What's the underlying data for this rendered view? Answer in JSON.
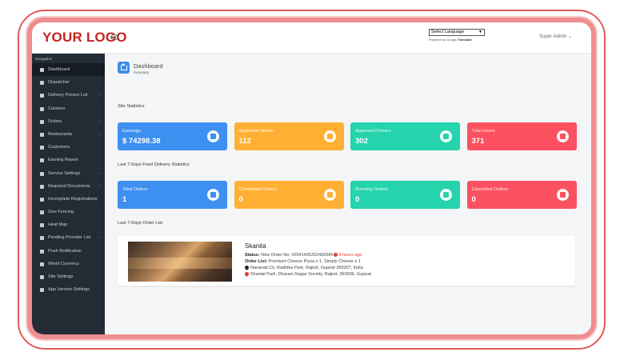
{
  "topbar": {
    "logo": "YOUR LOGO",
    "language_select": "Select Language",
    "powered_prefix": "Powered by Google",
    "powered_brand": "Translate",
    "user": "Super Admin"
  },
  "sidebar": {
    "title": "Navigation",
    "items": [
      {
        "label": "Dashboard",
        "icon": "home-icon",
        "chevron": false
      },
      {
        "label": "Dispatcher",
        "icon": "dispatcher-icon",
        "chevron": false
      },
      {
        "label": "Delivery Person List",
        "icon": "car-icon",
        "chevron": true
      },
      {
        "label": "Cuisines",
        "icon": "list-icon",
        "chevron": false
      },
      {
        "label": "Orders",
        "icon": "lock-icon",
        "chevron": true
      },
      {
        "label": "Restaurants",
        "icon": "store-icon",
        "chevron": true
      },
      {
        "label": "Customers",
        "icon": "user-icon",
        "chevron": false
      },
      {
        "label": "Earning Report",
        "icon": "report-icon",
        "chevron": false
      },
      {
        "label": "Service Settings",
        "icon": "cog-icon",
        "chevron": true
      },
      {
        "label": "Required Documents",
        "icon": "file-icon",
        "chevron": true
      },
      {
        "label": "Incomplete Registrations",
        "icon": "user-plus-icon",
        "chevron": false
      },
      {
        "label": "Geo Fencing",
        "icon": "truck-icon",
        "chevron": false
      },
      {
        "label": "Heat Map",
        "icon": "pin-icon",
        "chevron": false
      },
      {
        "label": "Pending Provider List",
        "icon": "user-clock-icon",
        "chevron": true
      },
      {
        "label": "Push Notification",
        "icon": "bell-icon",
        "chevron": false
      },
      {
        "label": "World Currency",
        "icon": "dollar-icon",
        "chevron": false
      },
      {
        "label": "Site Settings",
        "icon": "cogs-icon",
        "chevron": false
      },
      {
        "label": "App Version Settings",
        "icon": "wrench-icon",
        "chevron": false
      }
    ]
  },
  "header": {
    "title": "Dashboard",
    "subtitle": "Summary"
  },
  "site_stats": {
    "heading": "Site Statistics",
    "cards": [
      {
        "label": "Earnings",
        "value": "$ 74298.38",
        "icon": "money-icon",
        "color": "#3d8ff0"
      },
      {
        "label": "Approved Stores",
        "value": "112",
        "icon": "store-icon",
        "color": "#ffb034"
      },
      {
        "label": "Approved Drivers",
        "value": "302",
        "icon": "truck-icon",
        "color": "#25d3ac"
      },
      {
        "label": "Total Users",
        "value": "371",
        "icon": "users-icon",
        "color": "#fc5160"
      }
    ]
  },
  "food_stats": {
    "heading": "Last 7-Days Food Delivery Statistics",
    "cards": [
      {
        "label": "Total Orders",
        "value": "1",
        "icon": "bag-icon",
        "color": "#3d8ff0"
      },
      {
        "label": "Completed Orders",
        "value": "0",
        "icon": "check-icon",
        "color": "#ffb034"
      },
      {
        "label": "Running Orders",
        "value": "0",
        "icon": "spinner-icon",
        "color": "#25d3ac"
      },
      {
        "label": "Cancelled Orders",
        "value": "0",
        "icon": "x-icon",
        "color": "#fc5160"
      }
    ]
  },
  "order_list": {
    "heading": "Last 7-Days Order List",
    "order": {
      "name": "Skanita",
      "status_label": "Status:",
      "status_value": "New Order No: #2541495202402096",
      "time_ago": "4 hours ago",
      "items_label": "Order List:",
      "items_value": "Premium Cheese Pizza x 1, Simply Cheese x 1",
      "pickup": "Nanavati Cir, Radhika Park, Rajkot, Gujarat 360007, India",
      "dropoff": "Sheetal Park, Dharam Nagar Society, Rajkot, 360006, Gujarat"
    }
  }
}
